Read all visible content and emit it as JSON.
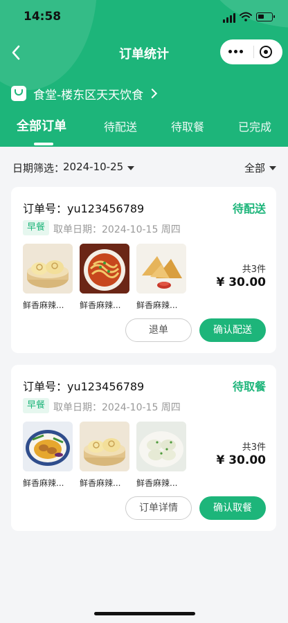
{
  "status_bar": {
    "time": "14:58"
  },
  "nav": {
    "title": "订单统计"
  },
  "store": {
    "name": "食堂-楼东区天天饮食"
  },
  "tabs": [
    {
      "label": "全部订单",
      "active": true
    },
    {
      "label": "待配送",
      "active": false
    },
    {
      "label": "待取餐",
      "active": false
    },
    {
      "label": "已完成",
      "active": false
    }
  ],
  "filter": {
    "label": "日期筛选：",
    "date": "2024-10-25",
    "category": "全部"
  },
  "orders": [
    {
      "order_no": "订单号：yu123456789",
      "status": "待配送",
      "meal_tag": "早餐",
      "pickup_date": "取单日期：2024-10-15 周四",
      "items": [
        {
          "name": "鲜香麻辣...",
          "icon": "steamed-buns-icon"
        },
        {
          "name": "鲜香麻辣...",
          "icon": "noodles-icon"
        },
        {
          "name": "鲜香麻辣...",
          "icon": "samosa-icon"
        }
      ],
      "count": "共3件",
      "price": "¥ 30.00",
      "secondary_button": "退单",
      "primary_button": "确认配送"
    },
    {
      "order_no": "订单号：yu123456789",
      "status": "待取餐",
      "meal_tag": "早餐",
      "pickup_date": "取单日期：2024-10-15 周四",
      "items": [
        {
          "name": "鲜香麻辣...",
          "icon": "curry-plate-icon"
        },
        {
          "name": "鲜香麻辣...",
          "icon": "steamed-buns-icon"
        },
        {
          "name": "鲜香麻辣...",
          "icon": "dumplings-icon"
        }
      ],
      "count": "共3件",
      "price": "¥ 30.00",
      "secondary_button": "订单详情",
      "primary_button": "确认取餐"
    }
  ],
  "colors": {
    "brand": "#1db57a",
    "tag_bg": "#e6f7ef",
    "page_bg": "#f4f5f7"
  }
}
